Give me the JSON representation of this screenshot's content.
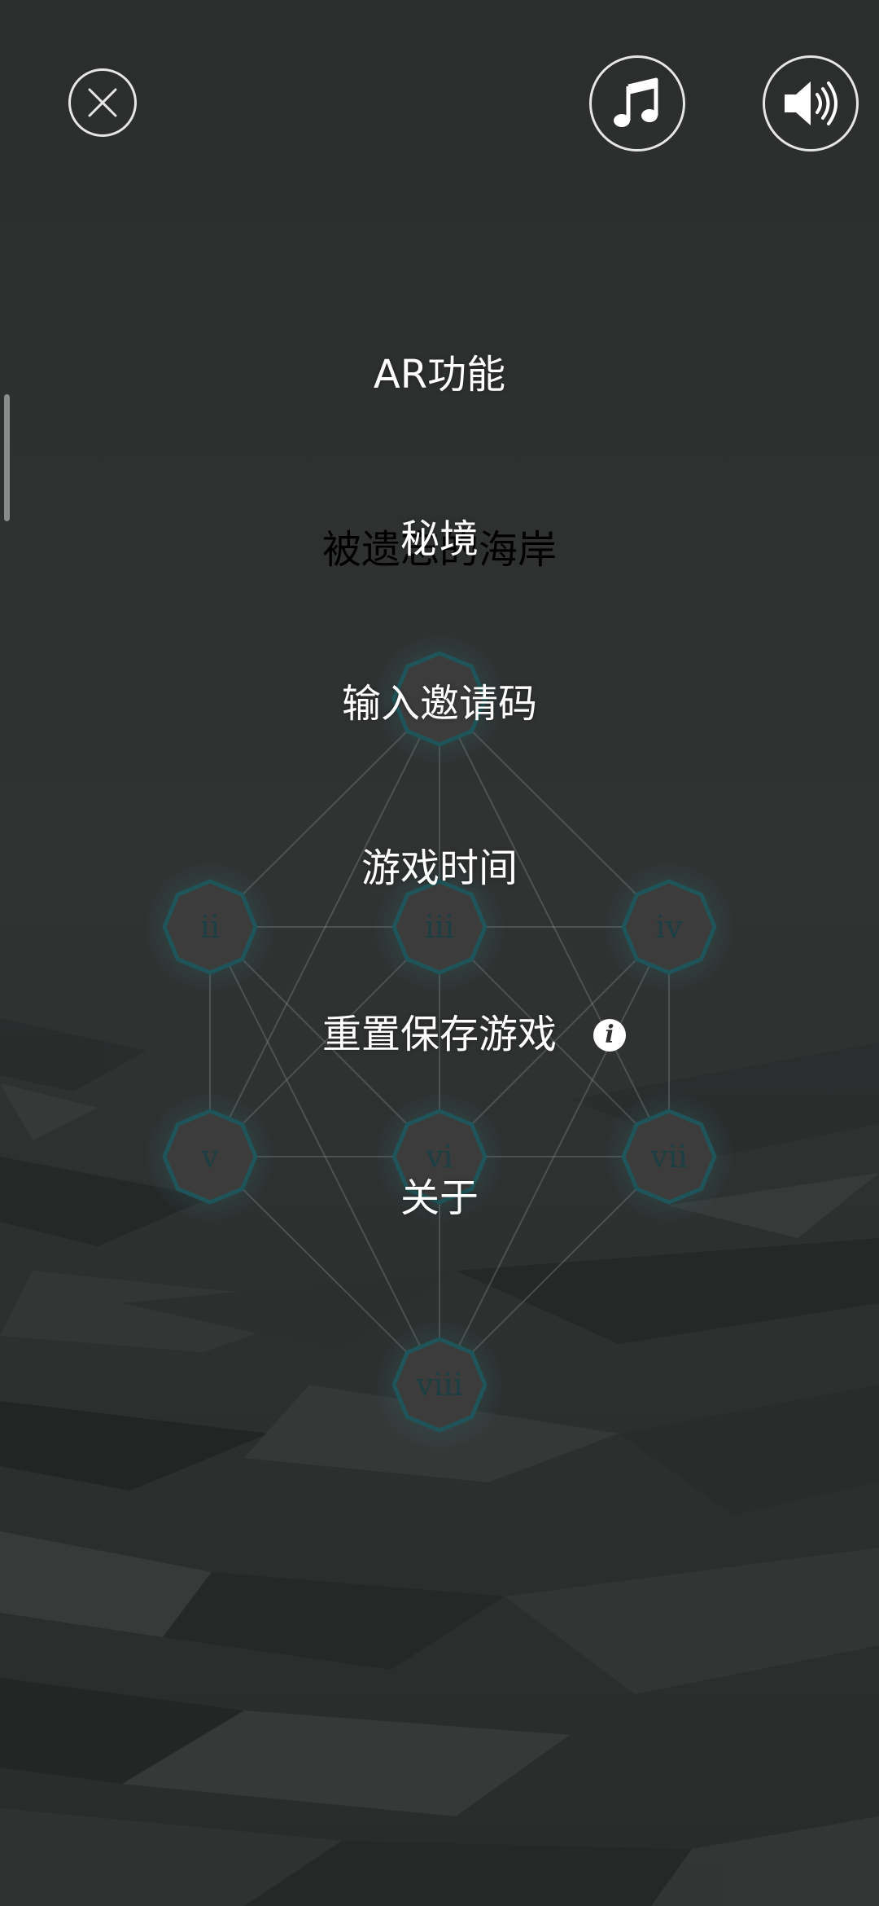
{
  "header": {
    "close_icon": "close-icon",
    "music_icon": "music-note-icon",
    "sound_icon": "speaker-icon"
  },
  "menu": {
    "items": [
      {
        "label": "AR功能"
      },
      {
        "label": "秘境"
      },
      {
        "label": "输入邀请码"
      },
      {
        "label": "游戏时间"
      },
      {
        "label": "重置保存游戏"
      },
      {
        "label": "关于"
      }
    ],
    "info_glyph": "i"
  },
  "background_map": {
    "stage_title": "被遗忘的海岸",
    "nodes": [
      {
        "id": "i",
        "label": ""
      },
      {
        "id": "ii",
        "label": "ii"
      },
      {
        "id": "iii",
        "label": "iii"
      },
      {
        "id": "iv",
        "label": "iv"
      },
      {
        "id": "v",
        "label": "v"
      },
      {
        "id": "vi",
        "label": "vi"
      },
      {
        "id": "vii",
        "label": "vii"
      },
      {
        "id": "viii",
        "label": "viii"
      }
    ]
  },
  "colors": {
    "background": "#2e3030",
    "node_fill": "#3c3c3c",
    "node_border": "#1f5558",
    "node_text": "#1d3f43",
    "menu_text": "#ffffff",
    "icon_stroke": "#e6e6e6"
  }
}
